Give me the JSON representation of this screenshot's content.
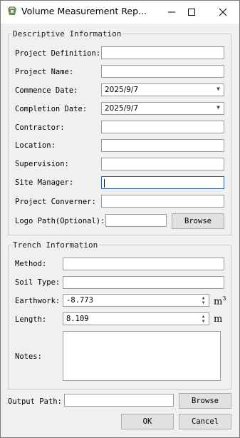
{
  "window": {
    "title": "Volume Measurement Rep..."
  },
  "descriptive": {
    "legend": "Descriptive Information",
    "project_definition_label": "Project Definition:",
    "project_name_label": "Project Name:",
    "commence_date_label": "Commence Date:",
    "commence_date_value": "2025/9/7",
    "completion_date_label": "Completion Date:",
    "completion_date_value": "2025/9/7",
    "contractor_label": "Contractor:",
    "location_label": "Location:",
    "supervision_label": "Supervision:",
    "site_manager_label": "Site Manager:",
    "project_converner_label": "Project Converner:",
    "logo_path_label": "Logo Path(Optional):",
    "browse_label": "Browse"
  },
  "trench": {
    "legend": "Trench Information",
    "method_label": "Method:",
    "soil_type_label": "Soil Type:",
    "earthwork_label": "Earthwork:",
    "earthwork_value": "-8.773",
    "earthwork_unit": "m",
    "earthwork_unit_sup": "3",
    "length_label": "Length:",
    "length_value": "8.109",
    "length_unit": "m",
    "notes_label": "Notes:"
  },
  "output": {
    "output_path_label": "Output Path:",
    "browse_label": "Browse",
    "ok_label": "OK",
    "cancel_label": "Cancel"
  },
  "icons": {
    "app": "app-icon",
    "minimize": "minimize-icon",
    "maximize": "maximize-icon",
    "close": "close-icon"
  }
}
